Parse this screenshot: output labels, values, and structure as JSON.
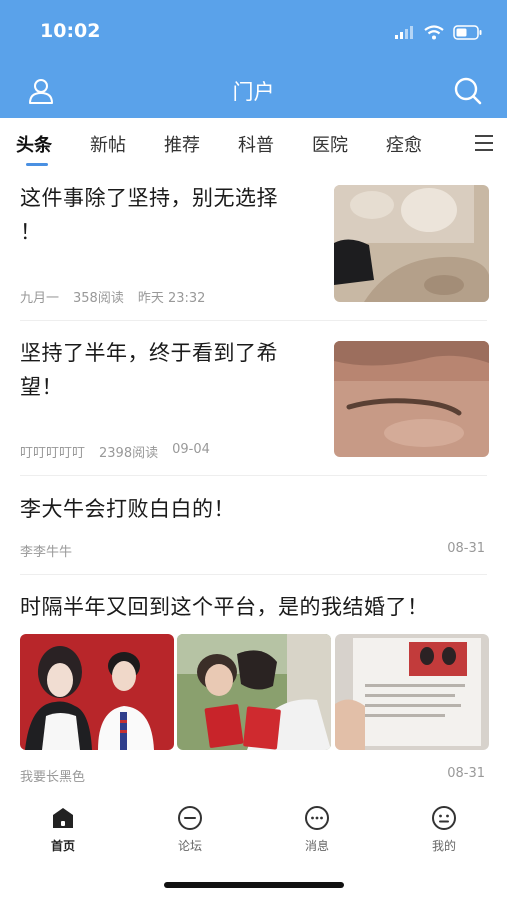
{
  "status_bar": {
    "time": "10:02"
  },
  "header": {
    "title": "门户"
  },
  "tabs": [
    {
      "label": "头条"
    },
    {
      "label": "新帖"
    },
    {
      "label": "推荐"
    },
    {
      "label": "科普"
    },
    {
      "label": "医院"
    },
    {
      "label": "痊愈"
    }
  ],
  "posts": [
    {
      "title_line1": "这件事除了坚持，别无选择",
      "title_line2": "！",
      "author": "九月一",
      "reads": "358阅读",
      "time": "昨天 23:32"
    },
    {
      "title_line1": "坚持了半年，终于看到了希",
      "title_line2": "望！",
      "author": "叮叮叮叮叮",
      "reads": "2398阅读",
      "time": "09-04"
    },
    {
      "title_line1": "李大牛会打败白白的！",
      "author": "李李牛牛",
      "time": "08-31"
    },
    {
      "title_line1": "时隔半年又回到这个平台，是的我结婚了！",
      "author": "我要长黑色",
      "time": "08-31"
    }
  ],
  "bottom_nav": [
    {
      "label": "首页",
      "icon": "home-icon"
    },
    {
      "label": "论坛",
      "icon": "forum-icon"
    },
    {
      "label": "消息",
      "icon": "message-icon"
    },
    {
      "label": "我的",
      "icon": "profile-icon"
    }
  ],
  "colors": {
    "header_bg": "#5aa2ea",
    "tab_indicator": "#4a90e2",
    "meta_text": "#999999"
  }
}
